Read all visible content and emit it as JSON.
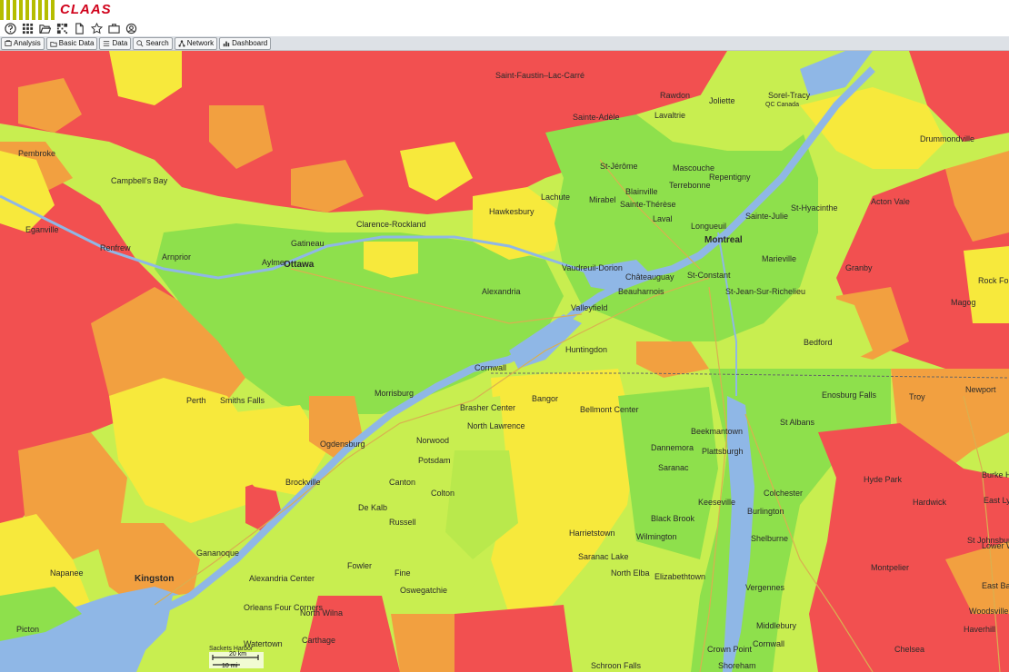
{
  "brand": {
    "logo_text": "CLAAS",
    "accent_color": "#b5bd00",
    "logo_color": "#d0021b"
  },
  "toolbar_icons": [
    "help-icon",
    "grid-icon",
    "folder-open-icon",
    "qr-code-icon",
    "new-document-icon",
    "star-icon",
    "briefcase-icon",
    "settings-icon"
  ],
  "nav": {
    "analysis": "Analysis",
    "basic_data": "Basic Data",
    "data": "Data",
    "search": "Search",
    "network": "Network",
    "dashboard": "Dashboard"
  },
  "map": {
    "heat_colors": {
      "high": "#f25050",
      "upper": "#f2a040",
      "mid": "#f7e93c",
      "low_mid": "#c8ee50",
      "low": "#8ee04c",
      "water": "#8fb7e6"
    },
    "labels": {
      "saint_faustin": "Saint-Faustin–Lac-Carré",
      "sainte_adele": "Sainte-Adèle",
      "st_jerome": "St-Jérôme",
      "mascouche": "Mascouche",
      "repentigny": "Repentigny",
      "terrebonne": "Terrebonne",
      "mirabel": "Mirabel",
      "blainville": "Blainville",
      "sainte_therese": "Sainte-Thérèse",
      "laval": "Laval",
      "longueuil": "Longueuil",
      "montreal": "Montreal",
      "sainte_julie": "Sainte-Julie",
      "st_hyacinthe": "St-Hyacinthe",
      "sorel_tracy": "Sorel-Tracy",
      "qc_canada": "QC Canada",
      "drummondville": "Drummondville",
      "acton_vale": "Acton Vale",
      "granby": "Granby",
      "st_jean": "St-Jean-Sur-Richelieu",
      "marieville": "Marieville",
      "chateauguay": "Châteauguay",
      "st_constant": "St-Constant",
      "vaudreuil": "Vaudreuil-Dorion",
      "beauharnois": "Beauharnois",
      "valleyfield": "Valleyfield",
      "lachute": "Lachute",
      "hawkesbury": "Hawkesbury",
      "clarence_rockland": "Clarence-Rockland",
      "gatineau": "Gatineau",
      "aylmer": "Aylmer",
      "ottawa": "Ottawa",
      "alexandria": "Alexandria",
      "pembroke": "Pembroke",
      "campbells_bay": "Campbell's Bay",
      "renfrew": "Renfrew",
      "arnprior": "Arnprior",
      "eganville": "Eganville",
      "smiths_falls": "Smiths Falls",
      "perth": "Perth",
      "brockville": "Brockville",
      "kingston": "Kingston",
      "napanee": "Napanee",
      "picton": "Picton",
      "cornwall": "Cornwall",
      "morrisburg": "Morrisburg",
      "ogdensburg": "Ogdensburg",
      "canton": "Canton",
      "potsdam": "Potsdam",
      "norwood": "Norwood",
      "colton": "Colton",
      "russell": "Russell",
      "de_kalb": "De Kalb",
      "fowler": "Fowler",
      "fine": "Fine",
      "oswegatchie": "Oswegatchie",
      "north_lawrence": "North Lawrence",
      "brasher_center": "Brasher Center",
      "bangor": "Bangor",
      "bellmont_center": "Bellmont Center",
      "dannemora": "Dannemora",
      "saranac": "Saranac",
      "beekmantown": "Beekmantown",
      "plattsburgh": "Plattsburgh",
      "keeseville": "Keeseville",
      "black_brook": "Black Brook",
      "burlington": "Burlington",
      "colchester": "Colchester",
      "st_albans": "St Albans",
      "enosburg_falls": "Enosburg Falls",
      "troy": "Troy",
      "newport": "Newport",
      "hyde_park": "Hyde Park",
      "hardwick": "Hardwick",
      "montpelier": "Montpelier",
      "st_johnsbury": "St Johnsbury",
      "east_lyndon": "East Lyndon",
      "burke_hollow": "Burke Hollow",
      "lower_waterford": "Lower Wa",
      "east_barnet": "East Barnet",
      "woodsville": "Woodsville",
      "haverhill": "Haverhill",
      "chelsea": "Chelsea",
      "middlebury": "Middlebury",
      "cornwall_vt": "Cornwall",
      "vergennes": "Vergennes",
      "shelburne": "Shelburne",
      "elizabethtown": "Elizabethtown",
      "wilmington": "Wilmington",
      "north_elba": "North Elba",
      "harrietstown": "Harrietstown",
      "saranac_lake": "Saranac Lake",
      "crown_point": "Crown Point",
      "shoreham": "Shoreham",
      "schroon_falls": "Schroon Falls",
      "watertown": "Watertown",
      "carthage": "Carthage",
      "north_wilna": "North Wilna",
      "alexandria_center": "Alexandria Center",
      "orleans_four_corners": "Orleans Four Corners",
      "sackets_harbor": "Sackets Harbor",
      "gananoque": "Gananoque",
      "huntingdon": "Huntingdon",
      "bedford": "Bedford",
      "magog": "Magog",
      "rock_forest": "Rock Forest",
      "rawdon": "Rawdon",
      "lavaltrie": "Lavaltrie",
      "joliette": "Joliette"
    },
    "scale": {
      "km": "20 km",
      "mi": "10 mi"
    }
  }
}
